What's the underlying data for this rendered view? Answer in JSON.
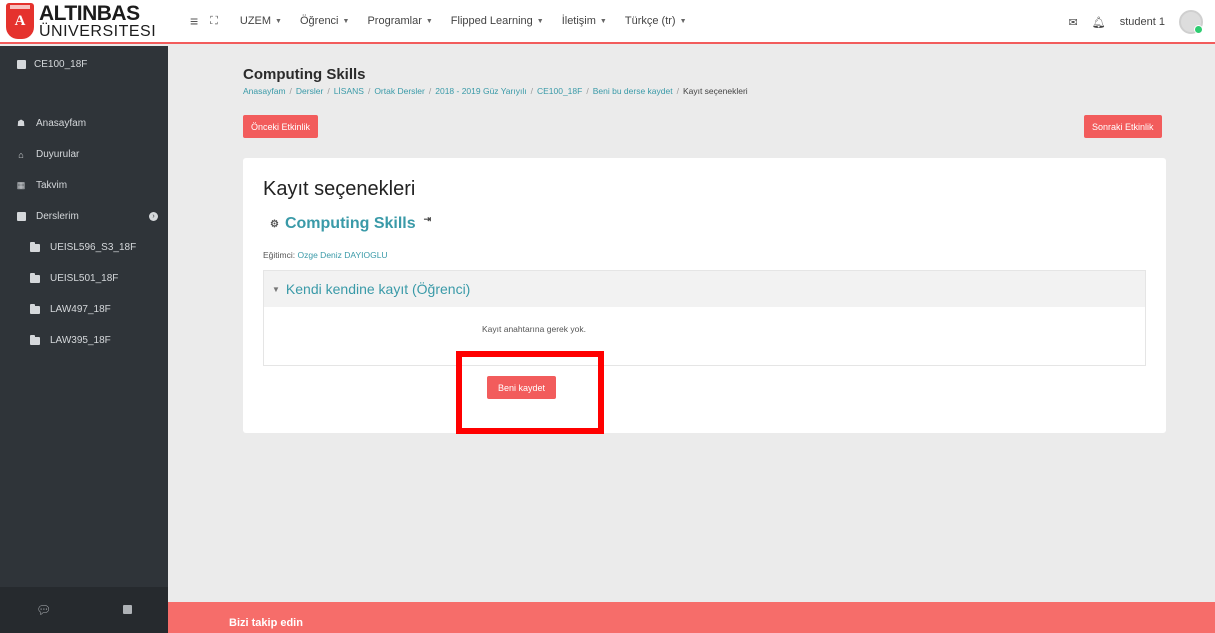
{
  "brand": {
    "line1": "ALTINBAS",
    "line2": "ÜNIVERSITESI",
    "shield_letter": "A"
  },
  "nav": {
    "menu": [
      {
        "label": "UZEM",
        "dropdown": true
      },
      {
        "label": "Öğrenci",
        "dropdown": true
      },
      {
        "label": "Programlar",
        "dropdown": true
      },
      {
        "label": "Flipped Learning",
        "dropdown": true
      },
      {
        "label": "İletişim",
        "dropdown": true
      },
      {
        "label": "Türkçe (tr)",
        "dropdown": true
      }
    ],
    "user": "student 1"
  },
  "sidebar": {
    "course": "CE100_18F",
    "items": [
      {
        "label": "Anasayfam"
      },
      {
        "label": "Duyurular"
      },
      {
        "label": "Takvim"
      },
      {
        "label": "Derslerim"
      }
    ],
    "courses": [
      {
        "label": "UEISL596_S3_18F"
      },
      {
        "label": "UEISL501_18F"
      },
      {
        "label": "LAW497_18F"
      },
      {
        "label": "LAW395_18F"
      }
    ]
  },
  "header": {
    "title": "Computing Skills",
    "breadcrumb": [
      "Anasayfam",
      "Dersler",
      "LİSANS",
      "Ortak Dersler",
      "2018 - 2019 Güz Yarıyılı",
      "CE100_18F",
      "Beni bu derse kaydet",
      "Kayıt seçenekleri"
    ]
  },
  "buttons": {
    "prev": "Önceki Etkinlik",
    "next": "Sonraki Etkinlik",
    "enrol": "Beni kaydet"
  },
  "main": {
    "heading": "Kayıt seçenekleri",
    "course_name": "Computing Skills",
    "teacher_label": "Eğitimci:",
    "teacher_name": "Ozge Deniz DAYIOGLU",
    "section_title": "Kendi kendine kayıt (Öğrenci)",
    "section_text": "Kayıt anahtarına gerek yok."
  },
  "footer": {
    "text": "Bizi takip edin"
  },
  "colors": {
    "accent": "#f25c5c",
    "link": "#3a9aa8",
    "sidebar": "#2f3439",
    "highlight": "#ff0000"
  }
}
